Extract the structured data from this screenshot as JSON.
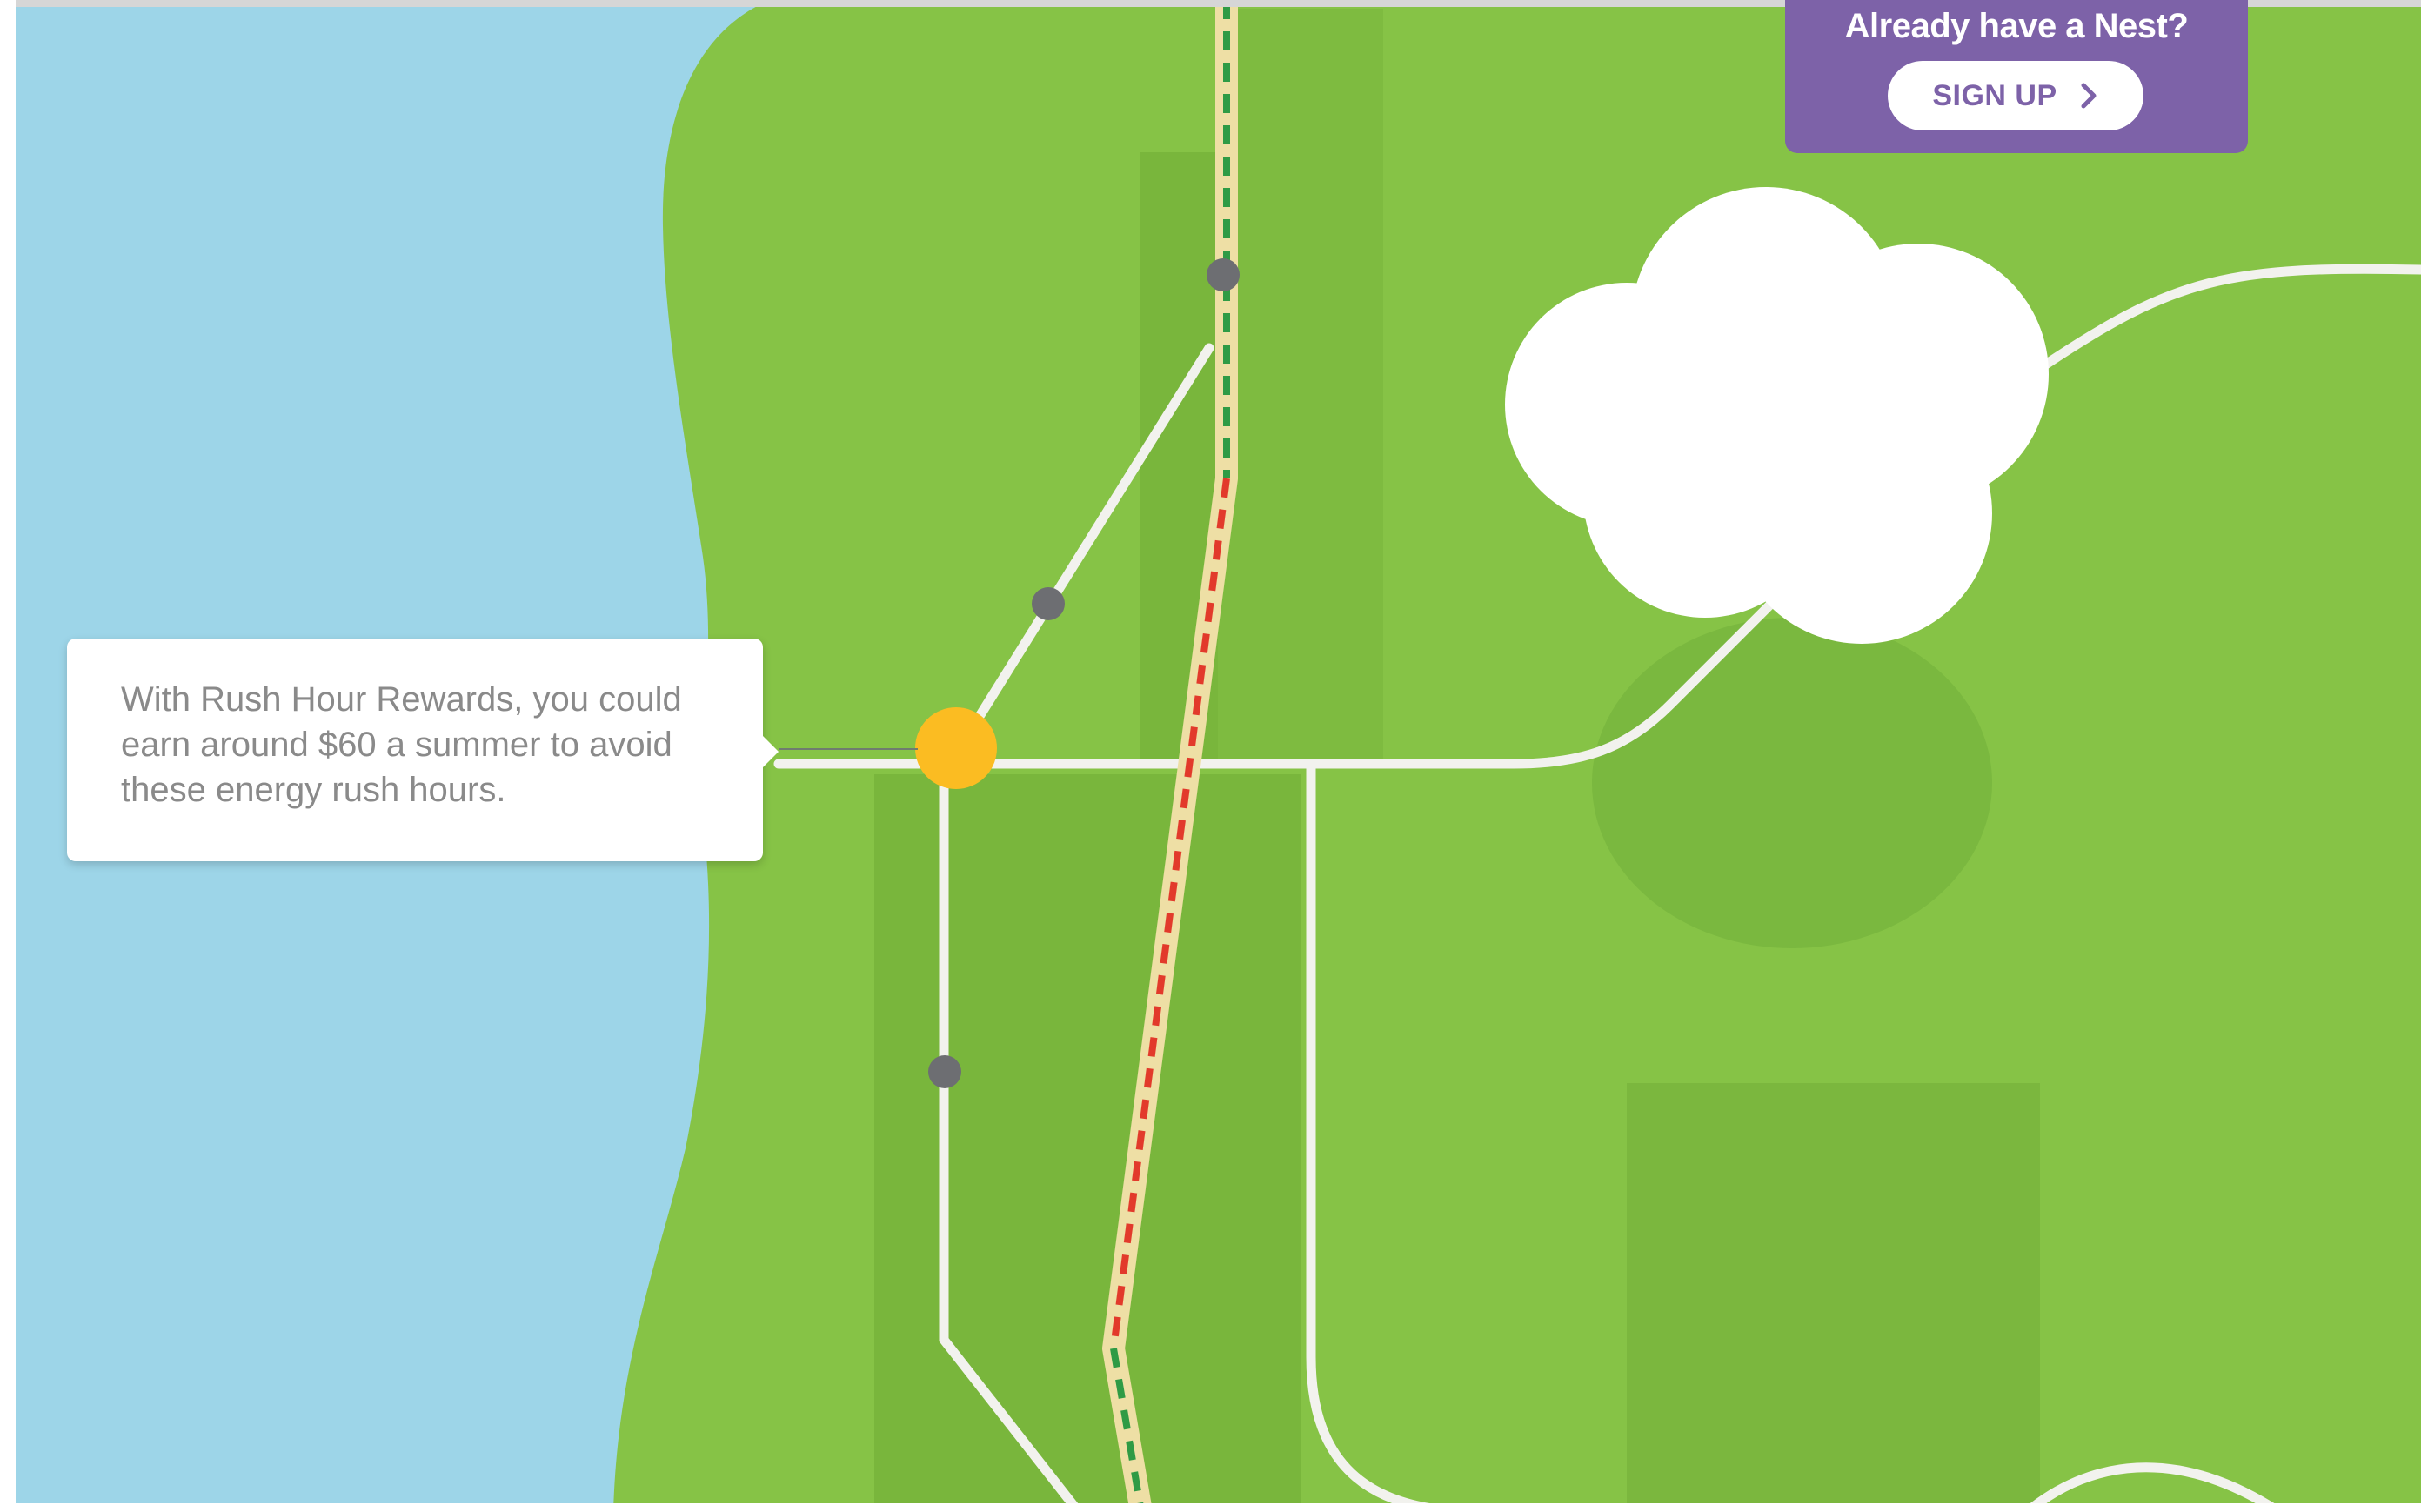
{
  "signup_panel": {
    "title": "Already have a Nest?",
    "button_label": "SIGN UP",
    "button_icon": "chevron-right-icon",
    "background_color": "#7d62a8",
    "text_color": "#ffffff"
  },
  "tooltip": {
    "text": "With Rush Hour Rewards, you could earn around $60 a summer to avoid these energy rush hours.",
    "text_color": "#8a8a8a"
  },
  "map": {
    "water_color": "#9dd5e8",
    "land_color": "#86c346",
    "land_dark_color": "#79b63c",
    "road_color": "#f2f2ee",
    "highway_casing_color": "#eedfa5",
    "traffic_clear_color": "#2f9b45",
    "traffic_heavy_color": "#e23a2b",
    "highlight_marker_color": "#fbbc22",
    "stop_marker_color": "#6d6e72",
    "cloud_color": "#ffffff"
  }
}
